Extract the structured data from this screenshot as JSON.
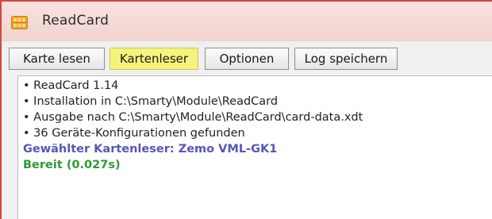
{
  "window": {
    "title": "ReadCard",
    "icon": "smartcard-chip-icon",
    "colors": {
      "titlebar": "#f4d9d5",
      "border": "#d4473c",
      "active_button": "#f4f47c"
    }
  },
  "toolbar": {
    "buttons": [
      {
        "label": "Karte lesen",
        "active": false
      },
      {
        "label": "Kartenleser",
        "active": true
      },
      {
        "label": "Optionen",
        "active": false
      },
      {
        "label": "Log speichern",
        "active": false
      }
    ]
  },
  "log": {
    "lines": [
      {
        "text": "• ReadCard 1.14",
        "style": "normal"
      },
      {
        "text": "• Installation in C:\\Smarty\\Module\\ReadCard",
        "style": "normal"
      },
      {
        "text": "• Ausgabe nach C:\\Smarty\\Module\\ReadCard\\card-data.xdt",
        "style": "normal"
      },
      {
        "text": "• 36 Geräte-Konfigurationen gefunden",
        "style": "normal"
      },
      {
        "text": "Gewählter Kartenleser: Zemo VML-GK1",
        "style": "info",
        "color": "#5656b8"
      },
      {
        "text": "Bereit (0.027s)",
        "style": "success",
        "color": "#2e9a36"
      }
    ]
  }
}
